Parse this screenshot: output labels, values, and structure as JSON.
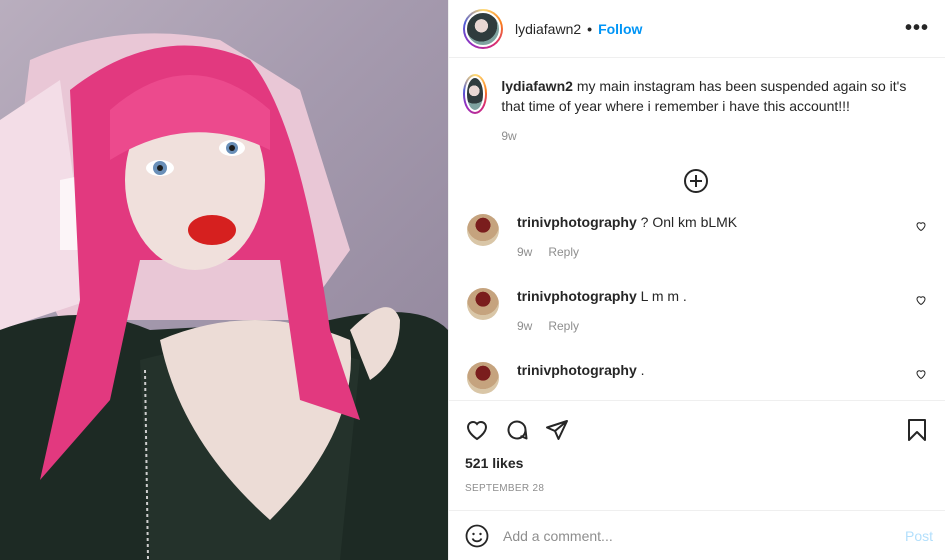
{
  "header": {
    "username": "lydiafawn2",
    "separator": "•",
    "follow_label": "Follow",
    "more_icon": "more-options-icon"
  },
  "caption": {
    "username": "lydiafawn2",
    "text": "my main instagram has been suspended again so it's that time of year where i remember i have this account!!!",
    "time": "9w"
  },
  "load_more_icon": "plus-circle-icon",
  "comments": [
    {
      "username": "trinivphotography",
      "text": "? Onl km bLMK",
      "time": "9w",
      "reply_label": "Reply"
    },
    {
      "username": "trinivphotography",
      "text": "L m m .",
      "time": "9w",
      "reply_label": "Reply"
    },
    {
      "username": "trinivphotography",
      "text": "."
    }
  ],
  "actions": {
    "icons": [
      "heart-icon",
      "comment-icon",
      "share-icon",
      "bookmark-icon"
    ],
    "likes": "521 likes",
    "date": "SEPTEMBER 28"
  },
  "add_comment": {
    "emoji_icon": "emoji-icon",
    "placeholder": "Add a comment...",
    "post_label": "Post"
  },
  "colors": {
    "follow": "#0095f6",
    "muted": "#8e8e8e",
    "post_disabled": "#b2dffc",
    "hair": "#e83c8c"
  }
}
